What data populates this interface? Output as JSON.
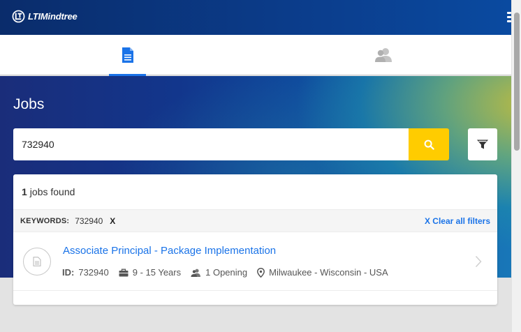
{
  "header": {
    "logo_text": "LTIMindtree"
  },
  "tabs": [
    {
      "name": "jobs",
      "icon": "document-icon",
      "active": true
    },
    {
      "name": "profile",
      "icon": "users-icon",
      "active": false
    }
  ],
  "page": {
    "title": "Jobs"
  },
  "search": {
    "value": "732940",
    "button_icon": "search-icon",
    "filter_icon": "funnel-icon"
  },
  "results": {
    "count": "1",
    "count_label": "jobs found",
    "filter_label": "KEYWORDS:",
    "filter_value": "732940",
    "filter_remove": "X",
    "clear_all": "X Clear all filters",
    "jobs": [
      {
        "title": "Associate Principal - Package Implementation",
        "id_label": "ID:",
        "id": "732940",
        "experience": "9 - 15 Years",
        "openings": "1 Opening",
        "location": "Milwaukee - Wisconsin - USA"
      }
    ]
  },
  "colors": {
    "accent": "#1a73e8",
    "search_button": "#ffcc00",
    "header": "#0b3d8c"
  }
}
